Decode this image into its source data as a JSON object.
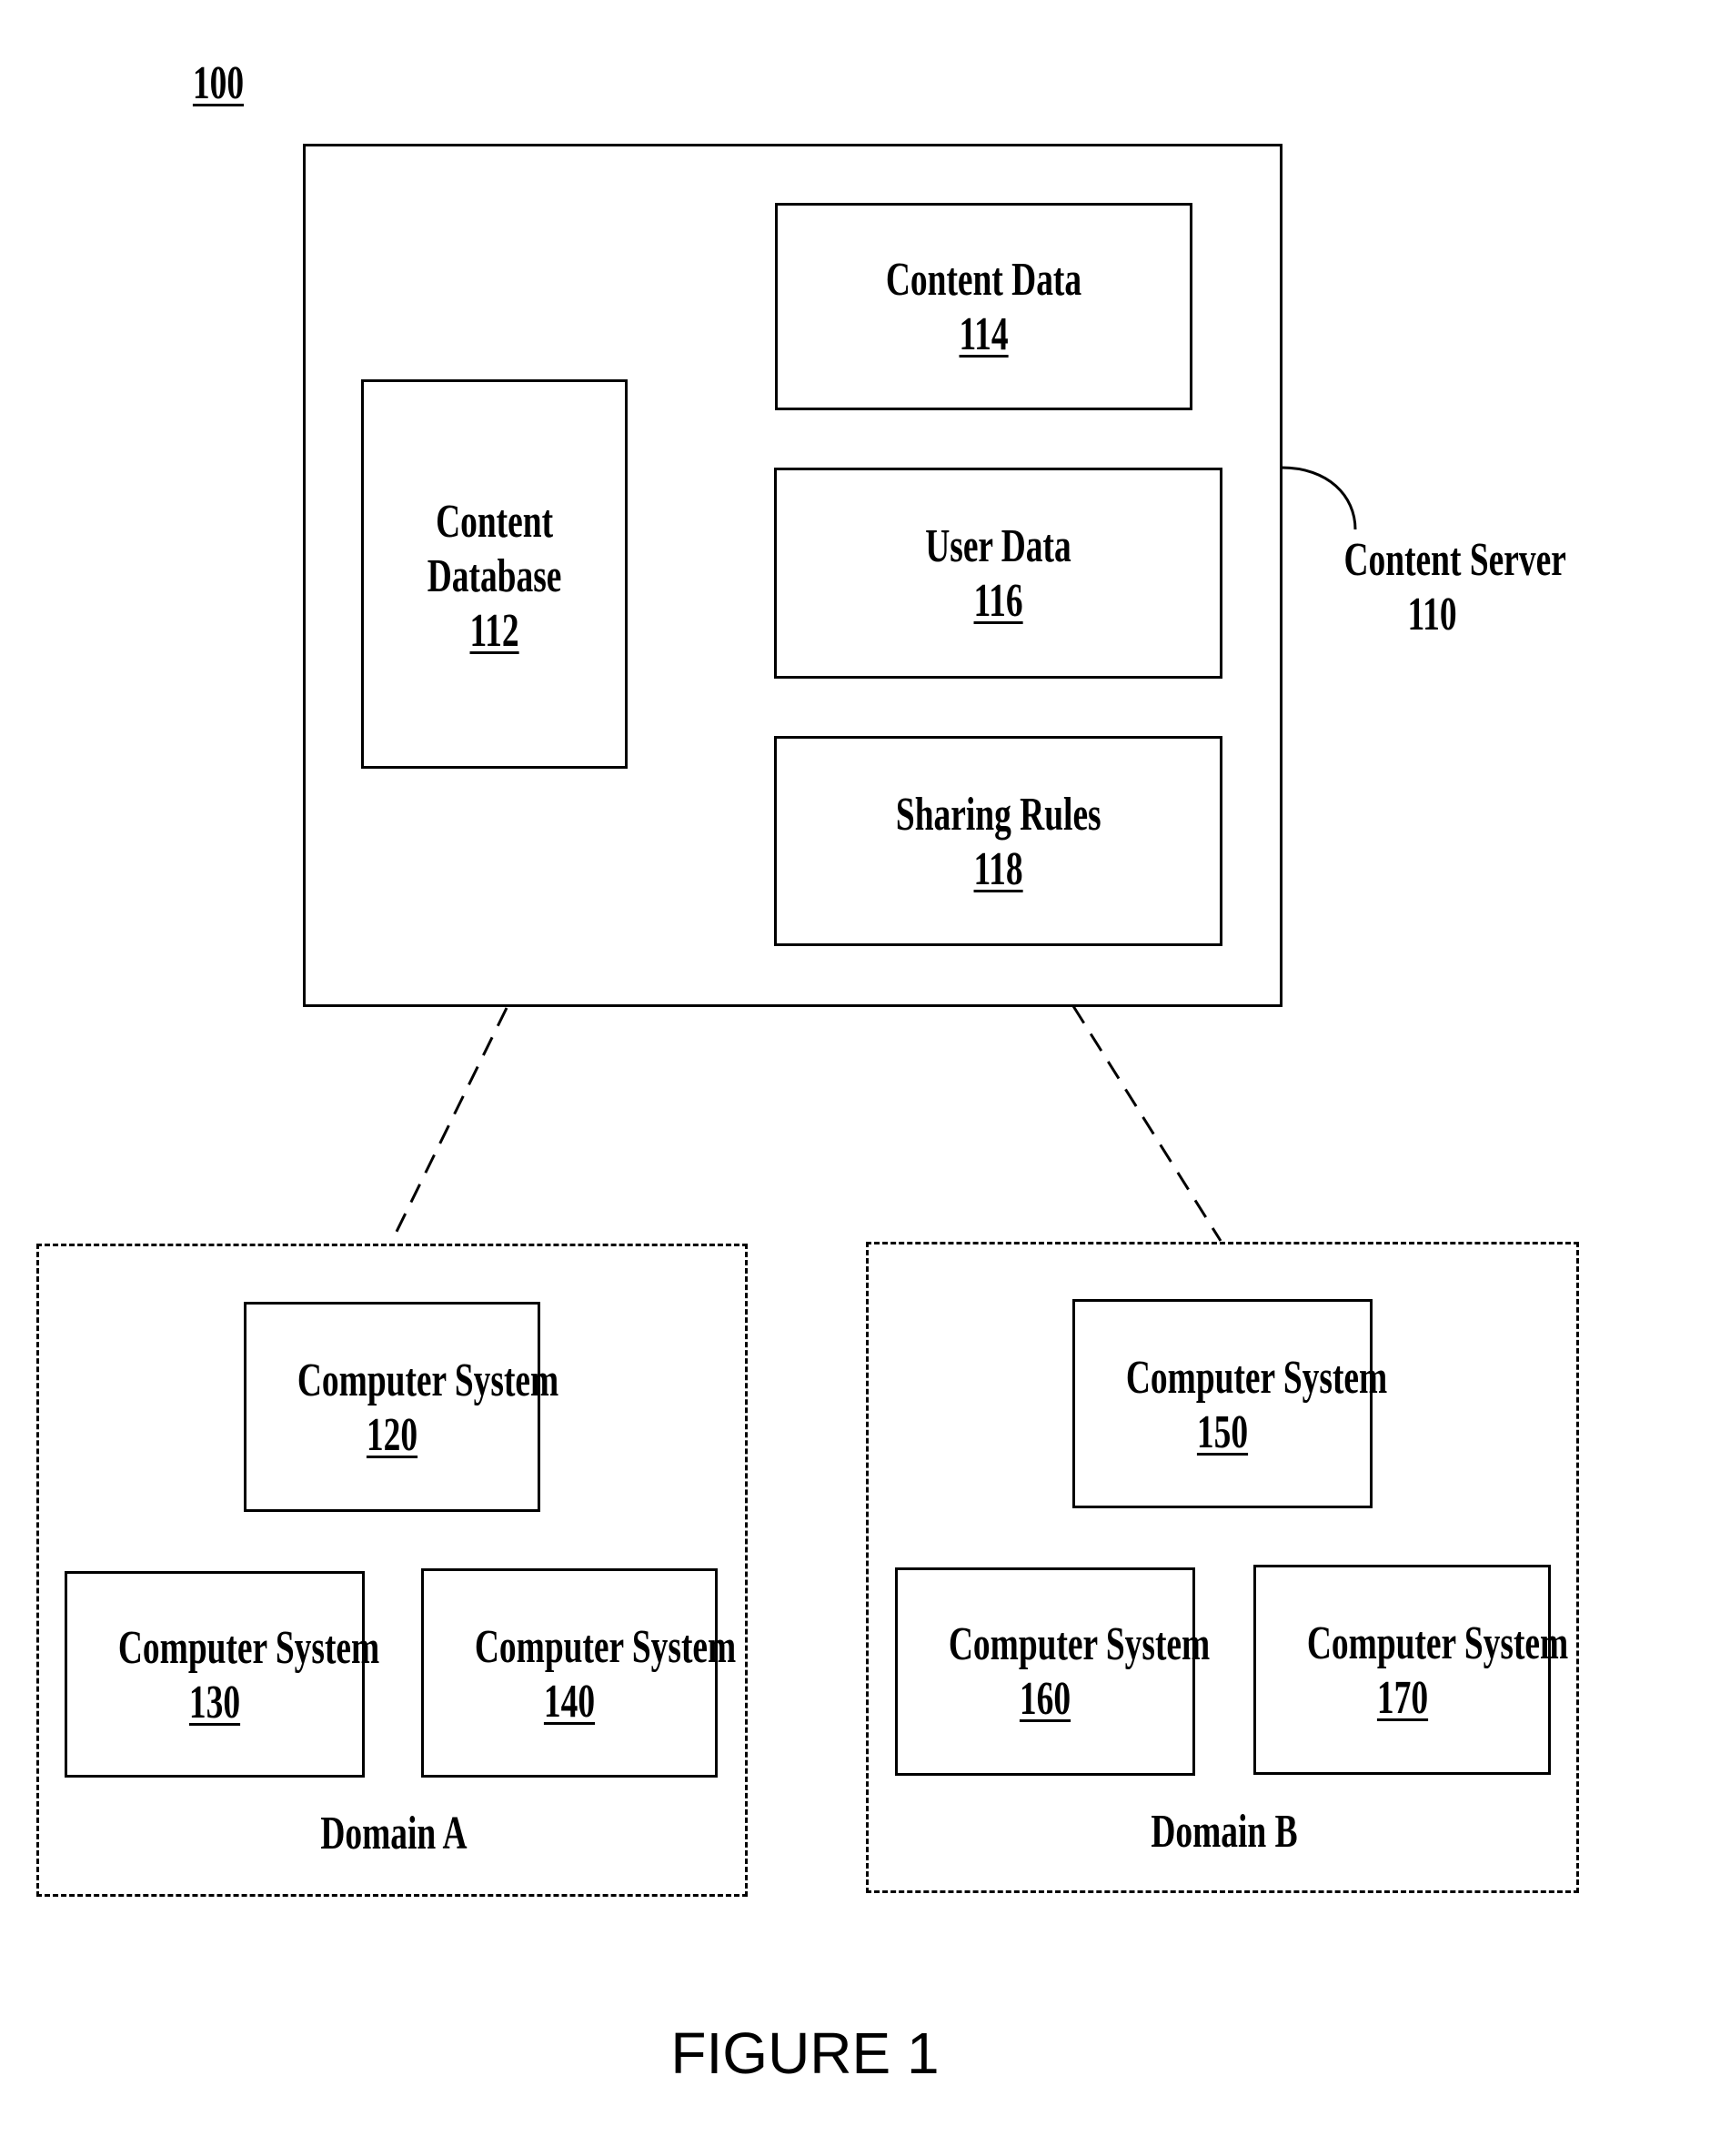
{
  "figure_ref": "100",
  "content_server": {
    "label": "Content Server",
    "ref": "110",
    "components": [
      {
        "name": "Content Database",
        "line1": "Content",
        "line2": "Database",
        "ref": "112"
      },
      {
        "name": "Content Data",
        "ref": "114"
      },
      {
        "name": "User Data",
        "ref": "116"
      },
      {
        "name": "Sharing Rules",
        "ref": "118"
      }
    ]
  },
  "domains": [
    {
      "label": "Domain A",
      "systems": [
        {
          "name": "Computer System",
          "ref": "120"
        },
        {
          "name": "Computer System",
          "ref": "130"
        },
        {
          "name": "Computer System",
          "ref": "140"
        }
      ]
    },
    {
      "label": "Domain B",
      "systems": [
        {
          "name": "Computer System",
          "ref": "150"
        },
        {
          "name": "Computer System",
          "ref": "160"
        },
        {
          "name": "Computer System",
          "ref": "170"
        }
      ]
    }
  ],
  "caption": "FIGURE 1"
}
